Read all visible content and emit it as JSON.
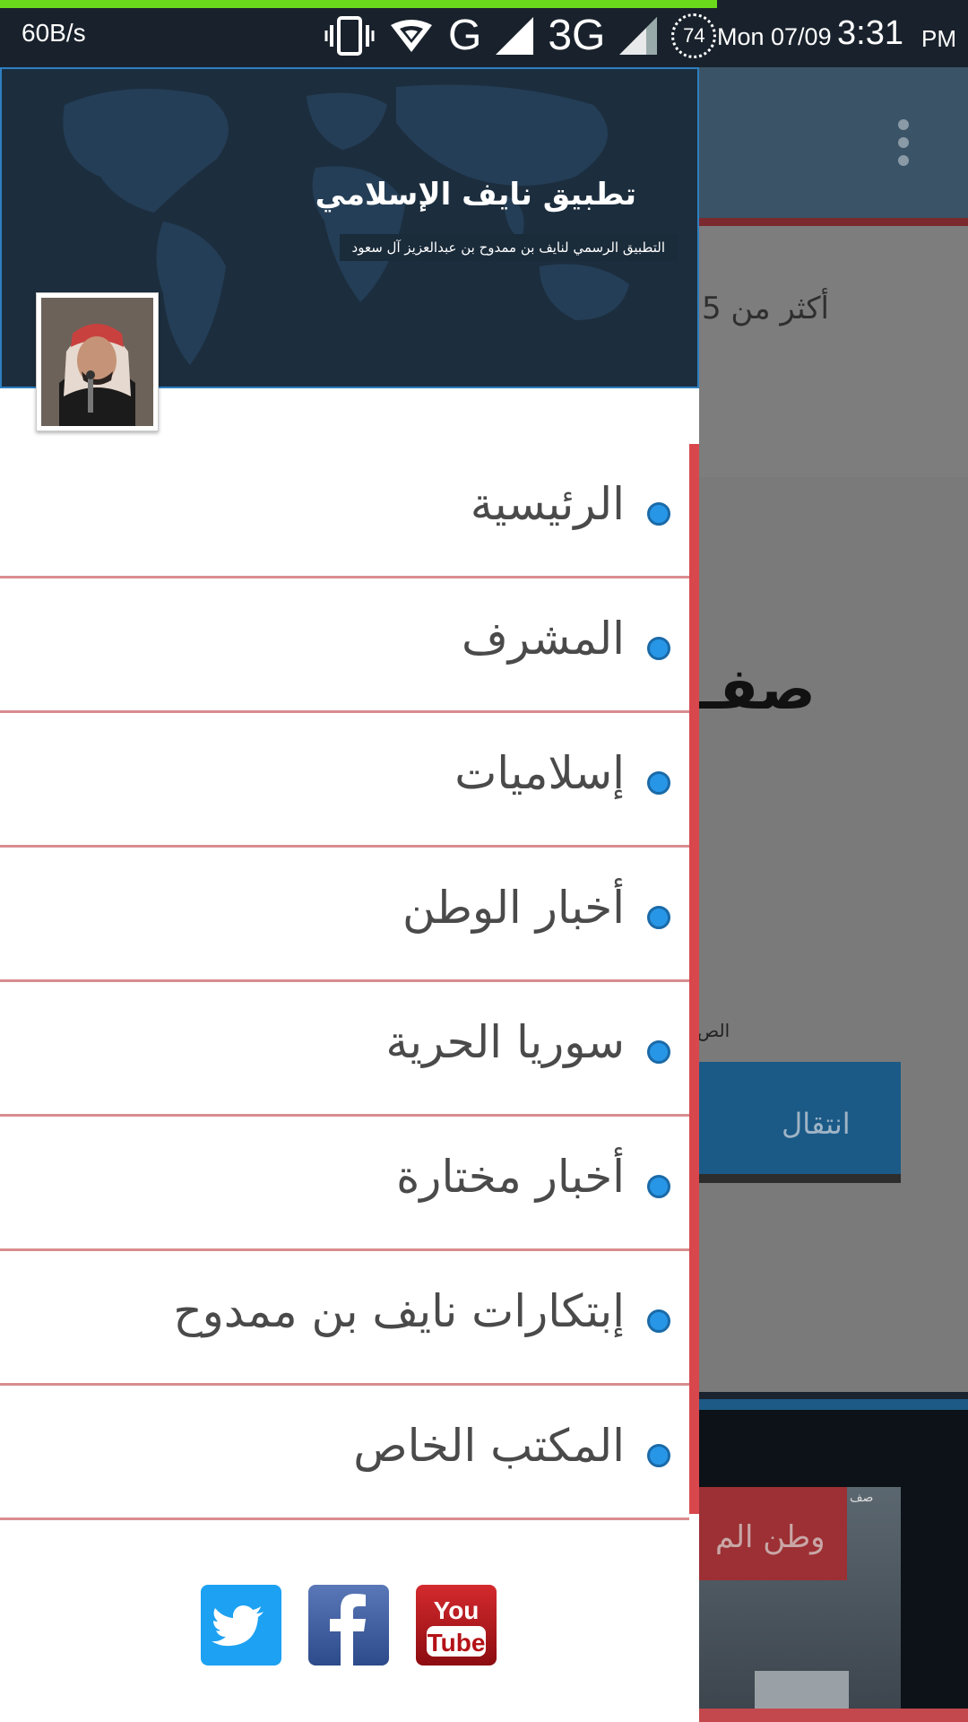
{
  "status_bar": {
    "net_speed": "60B/s",
    "network_g": "G",
    "network_3g": "3G",
    "battery": "74",
    "date": "Mon 07/09",
    "time": "3:31",
    "ampm": "PM"
  },
  "drawer": {
    "header": {
      "app_title": "تطبيق نايف الإسلامي",
      "app_subtitle": "التطبيق الرسمي لنايف بن ممدوح بن عبدالعزيز آل سعود"
    },
    "menu_items": [
      {
        "label": "الرئيسية"
      },
      {
        "label": "المشرف"
      },
      {
        "label": "إسلاميات"
      },
      {
        "label": "أخبار الوطن"
      },
      {
        "label": "سوريا الحرية"
      },
      {
        "label": "أخبار مختارة"
      },
      {
        "label": "إبتكارات نايف بن ممدوح"
      },
      {
        "label": "المكتب الخاص"
      }
    ],
    "social": [
      {
        "icon": "twitter-icon",
        "color": "#1da1f2"
      },
      {
        "icon": "facebook-icon",
        "color": "#3b5998"
      },
      {
        "icon": "youtube-icon",
        "color": "#b31217",
        "text_line1": "You",
        "text_line2": "Tube"
      }
    ]
  },
  "background": {
    "card_text": "أكثر من 5",
    "section_heading": "صفـ",
    "small_text": "الص",
    "button_label": "انتقال",
    "red_label": "وطن الم",
    "photo_caption": "صف"
  }
}
